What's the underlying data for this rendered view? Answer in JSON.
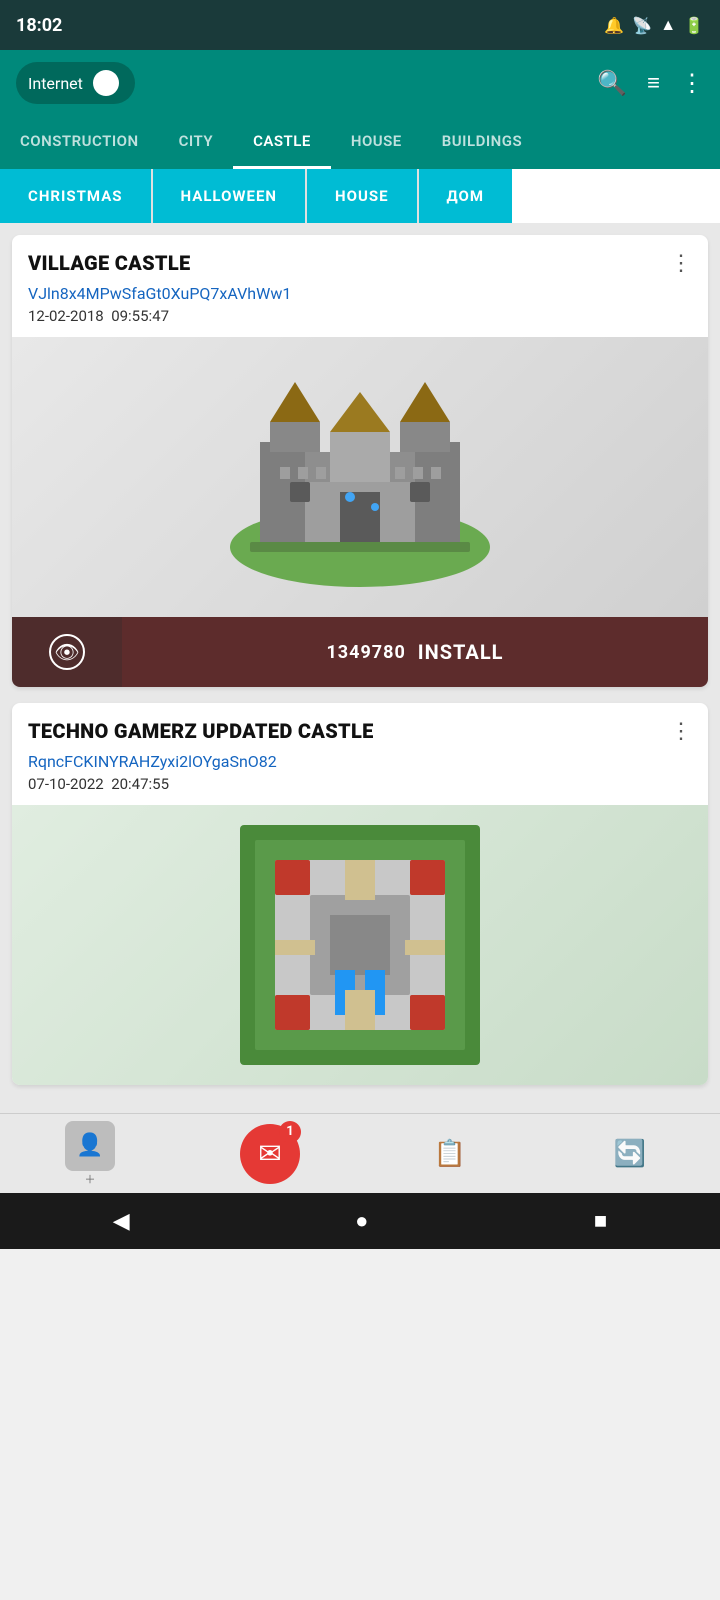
{
  "statusBar": {
    "time": "18:02",
    "icons": [
      "alert-icon",
      "cast-icon",
      "wifi-icon",
      "battery-icon"
    ]
  },
  "topBar": {
    "toggleLabel": "Internet",
    "actions": [
      "search-icon",
      "filter-icon",
      "more-icon"
    ]
  },
  "navTabs": {
    "items": [
      {
        "label": "CONSTRUCTION",
        "active": false
      },
      {
        "label": "CITY",
        "active": false
      },
      {
        "label": "CASTLE",
        "active": true
      },
      {
        "label": "HOUSE",
        "active": false
      },
      {
        "label": "BUILDINGS",
        "active": false
      }
    ]
  },
  "filterTags": [
    {
      "label": "CHRISTMAS"
    },
    {
      "label": "HALLOWEEN"
    },
    {
      "label": "HOUSE"
    },
    {
      "label": "ДОМ"
    }
  ],
  "cards": [
    {
      "title": "VILLAGE CASTLE",
      "link": "VJln8x4MPwSfaGt0XuPQ7xAVhWw1",
      "date": "12-02-2018",
      "time": "09:55:47",
      "installCount": "1349780",
      "installLabel": "INSTALL"
    },
    {
      "title": "TECHNO GAMERZ UPDATED CASTLE",
      "link": "RqncFCKINYRAHZyxi2lOYgaSnO82",
      "date": "07-10-2022",
      "time": "20:47:55",
      "installCount": "",
      "installLabel": ""
    }
  ],
  "bottomNav": {
    "items": [
      {
        "icon": "add-user-icon",
        "label": ""
      },
      {
        "icon": "inbox-icon",
        "badge": "1",
        "label": ""
      },
      {
        "icon": "clipboard-icon",
        "label": ""
      },
      {
        "icon": "refresh-icon",
        "label": ""
      }
    ]
  },
  "androidNav": {
    "back": "◀",
    "home": "●",
    "recent": "■"
  }
}
